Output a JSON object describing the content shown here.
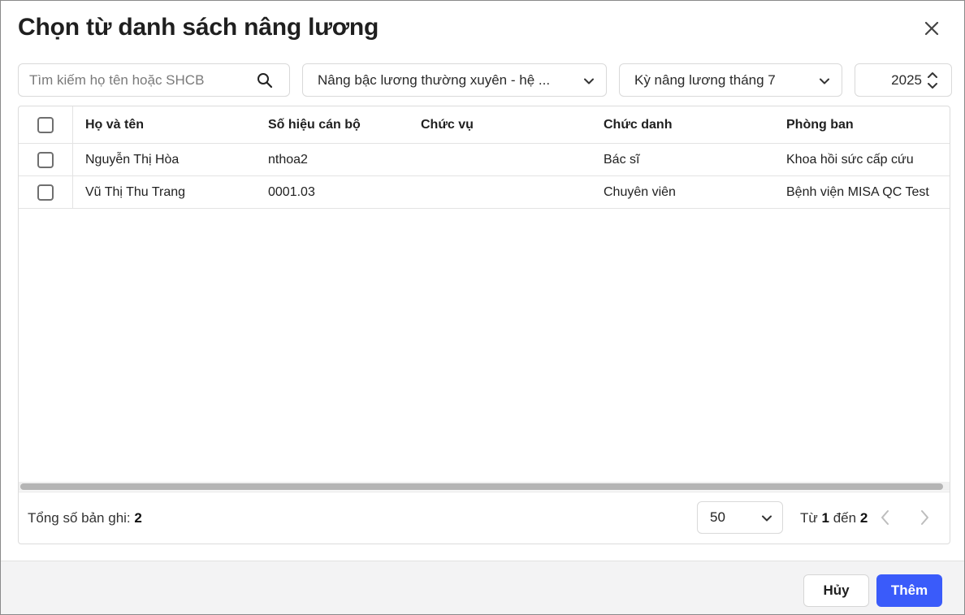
{
  "dialog": {
    "title": "Chọn từ danh sách nâng lương"
  },
  "filters": {
    "search_placeholder": "Tìm kiếm họ tên hoặc SHCB",
    "salary_type": "Nâng bậc lương thường xuyên - hệ ...",
    "period": "Kỳ nâng lương tháng 7",
    "year": "2025"
  },
  "table": {
    "columns": [
      "Họ và tên",
      "Số hiệu cán bộ",
      "Chức vụ",
      "Chức danh",
      "Phòng ban"
    ],
    "rows": [
      {
        "name": "Nguyễn Thị Hòa",
        "code": "nthoa2",
        "position": "",
        "title": "Bác sĩ",
        "department": "Khoa hồi sức cấp cứu"
      },
      {
        "name": "Vũ Thị Thu Trang",
        "code": "0001.03",
        "position": "",
        "title": "Chuyên viên",
        "department": "Bệnh viện MISA QC Test"
      }
    ]
  },
  "footer": {
    "total_label": "Tổng số bản ghi:",
    "total_count": "2",
    "page_size": "50",
    "range_from_label": "Từ",
    "range_from": "1",
    "range_to_label": "đến",
    "range_to": "2"
  },
  "actions": {
    "cancel_label": "Hủy",
    "add_label": "Thêm"
  },
  "icons": {
    "close": "close-icon",
    "search": "search-icon",
    "dropdown": "chevron-down-icon",
    "spinner": "spinner-updown-icon",
    "prev": "chevron-left-icon",
    "next": "chevron-right-icon"
  },
  "colors": {
    "primary": "#3a5bfa",
    "footer_bg": "#f3f3f4",
    "border": "#d9d9d9"
  }
}
